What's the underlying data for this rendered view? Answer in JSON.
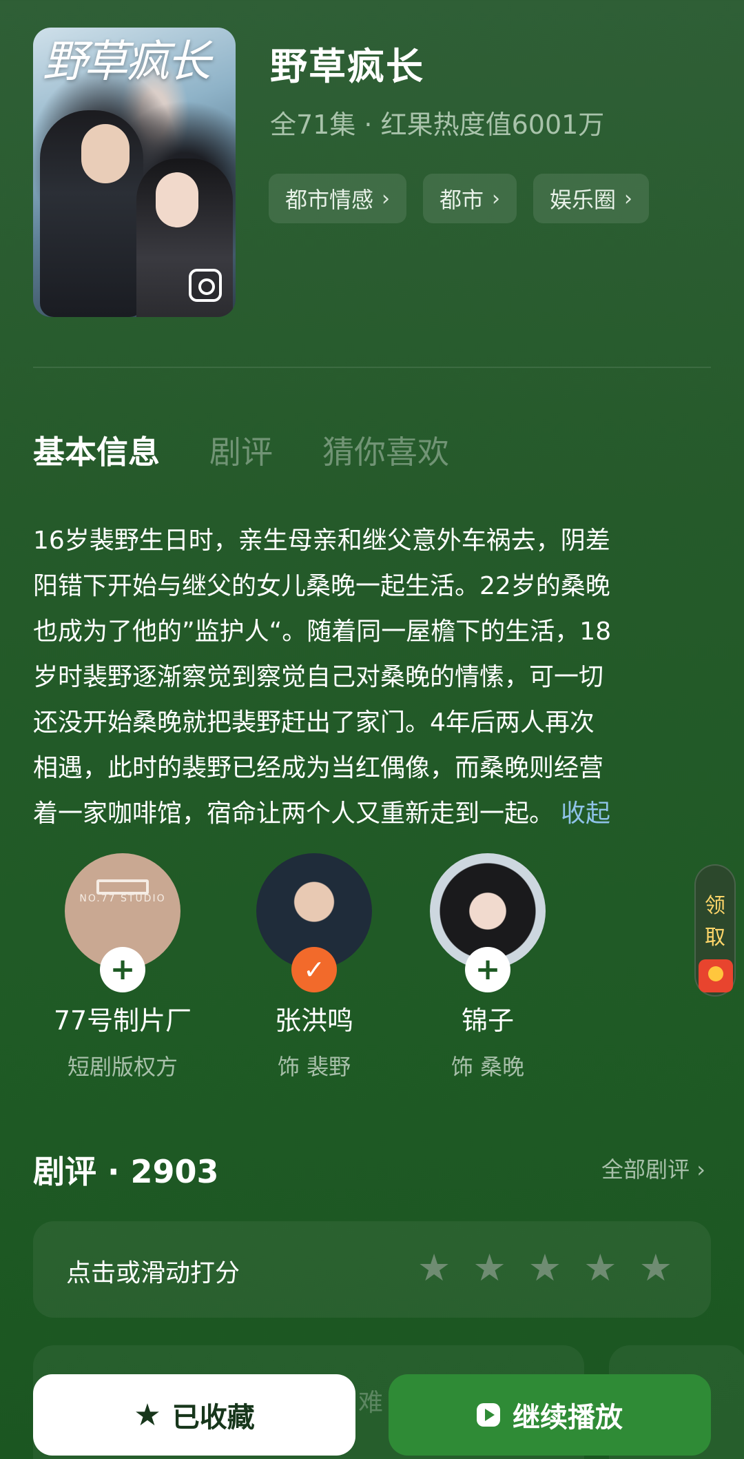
{
  "show": {
    "poster_title": "野草疯长",
    "title": "野草疯长",
    "meta": "全71集 · 红果热度值6001万",
    "tags": [
      {
        "label": "都市情感"
      },
      {
        "label": "都市"
      },
      {
        "label": "娱乐圈"
      }
    ]
  },
  "tabs": [
    {
      "label": "基本信息",
      "active": true
    },
    {
      "label": "剧评",
      "active": false
    },
    {
      "label": "猜你喜欢",
      "active": false
    }
  ],
  "synopsis": {
    "lines": [
      "16岁裴野生日时，亲生母亲和继父意外车祸去，阴差",
      "阳错下开始与继父的女儿桑晚一起生活。22岁的桑晚",
      "也成为了他的”监护人“。随着同一屋檐下的生活，18",
      "岁时裴野逐渐察觉到察觉自己对桑晚的情愫，可一切",
      "还没开始桑晚就把裴野赶出了家门。4年后两人再次",
      "相遇，此时的裴野已经成为当红偶像，而桑晚则经营",
      "着一家咖啡馆，宿命让两个人又重新走到一起。"
    ],
    "collapse_label": "收起"
  },
  "cast": [
    {
      "name": "77号制片厂",
      "role": "短剧版权方",
      "avatar": "studio-logo",
      "logo_text": "NO.77 STUDIO",
      "followed": false
    },
    {
      "name": "张洪鸣",
      "role": "饰 裴野",
      "avatar": "actor-photo",
      "followed": true
    },
    {
      "name": "锦子",
      "role": "饰 桑晚",
      "avatar": "actress-photo",
      "followed": false
    }
  ],
  "gift_widget": {
    "text_1": "领",
    "text_2": "取",
    "icon": "red-packet-icon"
  },
  "reviews": {
    "title": "剧评 · 2903",
    "all_label": "全部剧评 ›",
    "rate_prompt": "点击或滑动打分",
    "star_count": 5,
    "peek_text": "难"
  },
  "bottom_bar": {
    "favorite_label": "已收藏",
    "play_label": "继续播放"
  },
  "colors": {
    "background": "#255a2a",
    "accent_play": "#2f8b36",
    "followed_badge": "#f26a2b",
    "collapse_link": "#8fc3e8"
  }
}
